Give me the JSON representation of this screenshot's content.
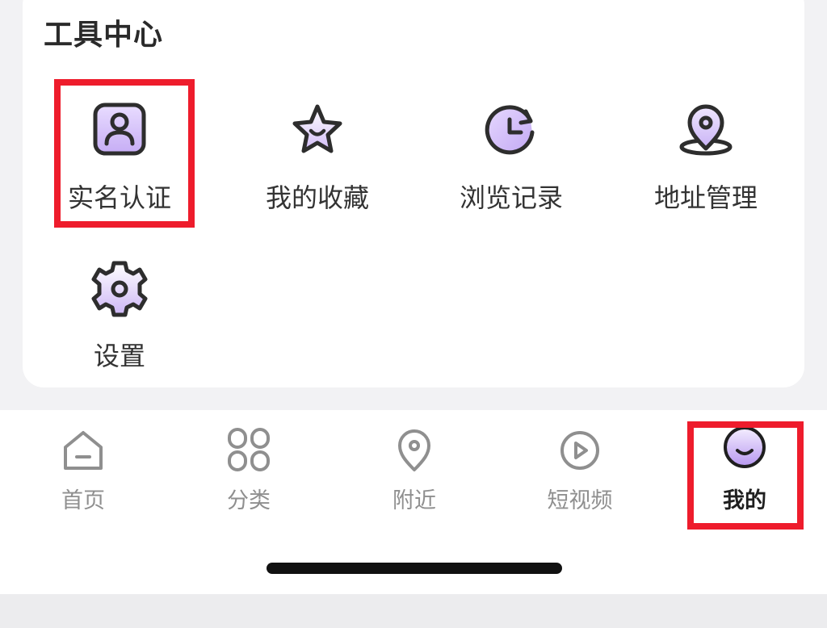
{
  "tool_center": {
    "title": "工具中心",
    "items": [
      {
        "label": "实名认证",
        "icon": "user-id-icon"
      },
      {
        "label": "我的收藏",
        "icon": "star-icon"
      },
      {
        "label": "浏览记录",
        "icon": "history-clock-icon"
      },
      {
        "label": "地址管理",
        "icon": "location-pin-icon"
      },
      {
        "label": "设置",
        "icon": "gear-icon"
      }
    ]
  },
  "tabbar": {
    "tabs": [
      {
        "label": "首页",
        "icon": "home-icon"
      },
      {
        "label": "分类",
        "icon": "grid-icon"
      },
      {
        "label": "附近",
        "icon": "location-icon"
      },
      {
        "label": "短视频",
        "icon": "play-icon"
      },
      {
        "label": "我的",
        "icon": "profile-face-icon",
        "active": true
      }
    ]
  },
  "colors": {
    "accent_purple": "#c9b3f5",
    "highlight_red": "#ee1c2c",
    "icon_stroke": "#2d2d2d",
    "tab_inactive": "#8f8f8f"
  }
}
